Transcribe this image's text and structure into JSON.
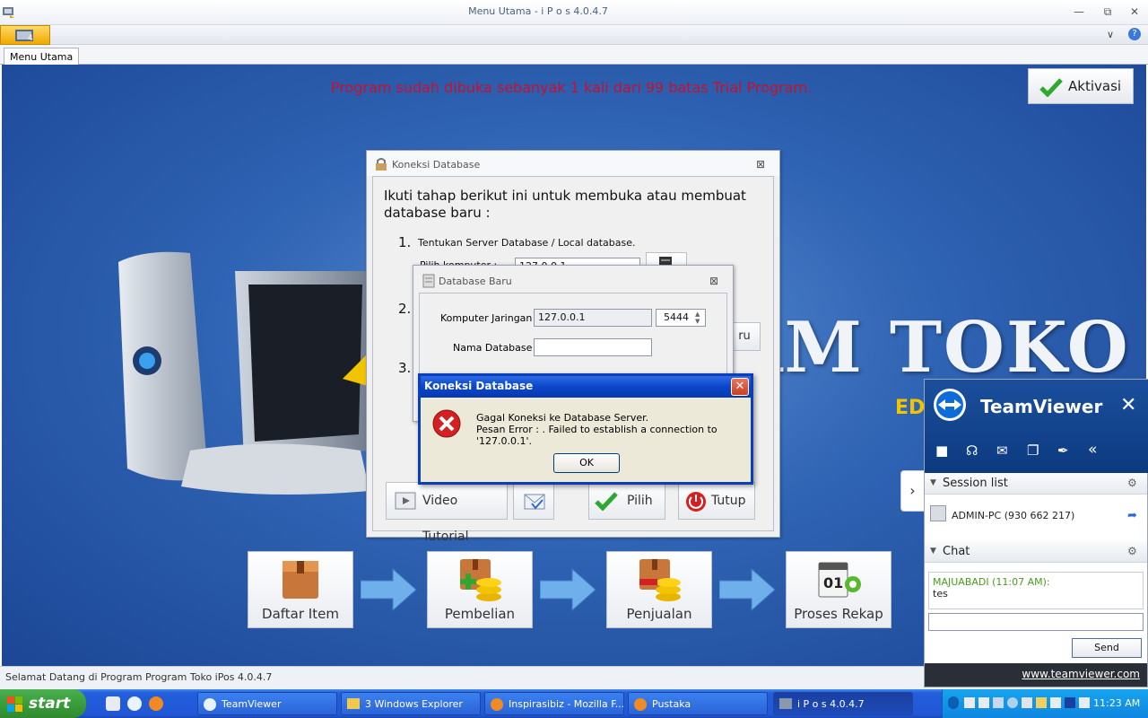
{
  "window": {
    "title": "Menu Utama - i P o s 4.0.4.7"
  },
  "tabs": [
    {
      "label": "Menu Utama"
    }
  ],
  "main": {
    "trial_notice": "Program sudah dibuka sebanyak 1 kali dari 99 batas Trial Program.",
    "aktivasi_label": "Aktivasi",
    "brand_text": "AM TOKO",
    "edition_text": "ED",
    "workflow": [
      {
        "label": "Daftar Item"
      },
      {
        "label": "Pembelian"
      },
      {
        "label": "Penjualan"
      },
      {
        "label": "Proses Rekap"
      }
    ]
  },
  "statusbar": {
    "text": "Selamat Datang di Program Program Toko iPos 4.0.4.7"
  },
  "koneksi_dialog": {
    "title": "Koneksi Database",
    "instruction": "Ikuti tahap berikut ini untuk membuka atau membuat database baru :",
    "step1_num": "1.",
    "step1_text": "Tentukan Server Database / Local database.",
    "pilih_komputer_label": "Pilih komputer :",
    "pilih_komputer_value": "127.0.0.1",
    "step2_num": "2.",
    "step3_num": "3.",
    "baru_label": "ru",
    "video_tutorial_label": "Video Tutorial",
    "pilih_label": "Pilih",
    "tutup_label": "Tutup"
  },
  "database_baru_dialog": {
    "title": "Database Baru",
    "komputer_label": "Komputer Jaringan :",
    "komputer_value": "127.0.0.1",
    "port_value": "5444",
    "nama_label": "Nama Database :",
    "nama_value": ""
  },
  "error_dialog": {
    "title": "Koneksi Database",
    "line1": "Gagal Koneksi ke Database Server.",
    "line2": "Pesan Error :  . Failed to establish a connection to '127.0.0.1'.",
    "ok_label": "OK"
  },
  "teamviewer": {
    "name": "TeamViewer",
    "session_list_label": "Session list",
    "session_item": "ADMIN-PC (930 662 217)",
    "chat_label": "Chat",
    "chat_sender": "MAJUABADI (11:07 AM):",
    "chat_message": "tes",
    "chat_input": "",
    "send_label": "Send",
    "footer_link": "www.teamviewer.com"
  },
  "taskbar": {
    "start_label": "start",
    "tasks": [
      {
        "label": "TeamViewer"
      },
      {
        "label": "3 Windows Explorer"
      },
      {
        "label": "Inspirasibiz - Mozilla F..."
      },
      {
        "label": "Pustaka"
      },
      {
        "label": "i P o s 4.0.4.7"
      }
    ],
    "clock": "11:23 AM"
  },
  "colors": {
    "trial_red": "#c8102e",
    "main_blue": "#2f63b3",
    "xp_title_blue": "#0a46c8",
    "tv_blue": "#0c3a80"
  }
}
